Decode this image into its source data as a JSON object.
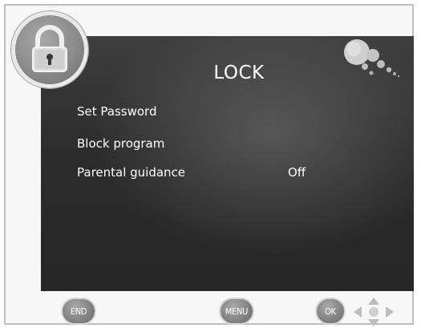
{
  "screen": {
    "title": "LOCK"
  },
  "menu": {
    "items": [
      {
        "label": "Set Password",
        "value": ""
      },
      {
        "label": "Block program",
        "value": ""
      },
      {
        "label": "Parental guidance",
        "value": "Off"
      }
    ]
  },
  "footer": {
    "end_label": "END",
    "menu_label": "MENU",
    "ok_label": "OK"
  },
  "icons": {
    "header": "padlock-icon",
    "decor": "bubbles-icon",
    "nav": "arrow-keys-icon"
  }
}
